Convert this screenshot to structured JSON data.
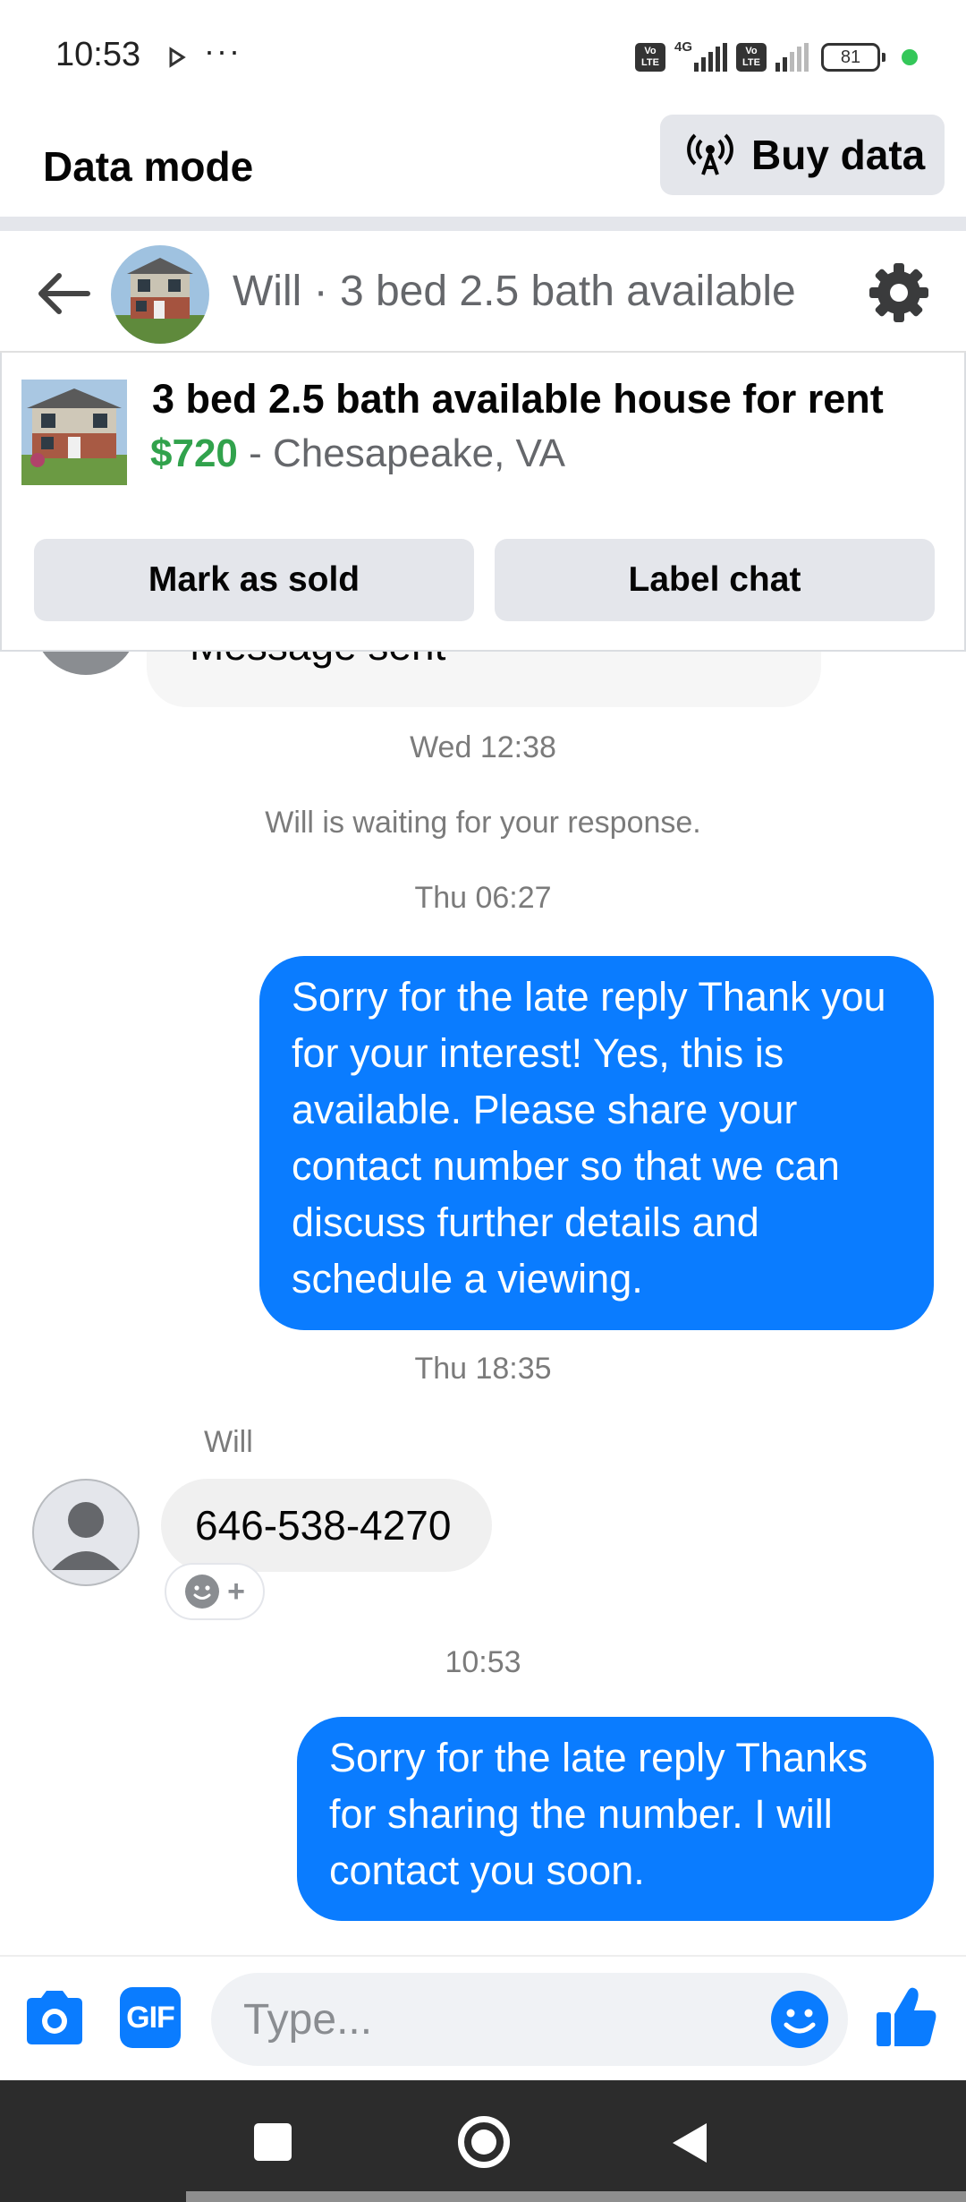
{
  "status_bar": {
    "time": "10:53",
    "more": "···",
    "network": "4G",
    "battery": "81",
    "volte_label": "Vo LTE"
  },
  "data_mode": {
    "title": "Data mode",
    "buy_label": "Buy data"
  },
  "conversation": {
    "title": "Will · 3 bed 2.5 bath available"
  },
  "listing": {
    "title": "3 bed 2.5 bath available house for rent",
    "price": "$720",
    "location": " - Chesapeake, VA",
    "mark_sold_label": "Mark as sold",
    "label_chat_label": "Label chat"
  },
  "messages": {
    "partial_text": "Message sent",
    "ts1": "Wed 12:38",
    "waiting": "Will is waiting for your response.",
    "ts2": "Thu 06:27",
    "out1": "Sorry for the late reply Thank you for your interest! Yes, this is available. Please share your contact number so that we can discuss further details and schedule a viewing.",
    "ts3": "Thu 18:35",
    "sender": "Will",
    "in1": "646-538-4270",
    "react_plus": "+",
    "ts4": "10:53",
    "out2": "Sorry for the late reply Thanks for sharing the number. I will contact you soon."
  },
  "composer": {
    "gif_label": "GIF",
    "placeholder": "Type..."
  },
  "colors": {
    "accent": "#0a7cff",
    "price_green": "#31a24c",
    "button_gray": "#e4e6eb"
  }
}
